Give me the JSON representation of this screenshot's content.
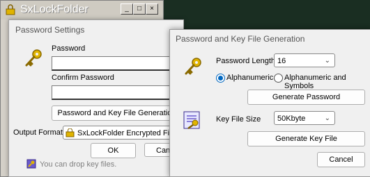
{
  "app": {
    "title": "SxLockFolder"
  },
  "password_settings": {
    "title": "Password Settings",
    "password_label": "Password",
    "password_value": "",
    "confirm_label": "Confirm Password",
    "confirm_value": "",
    "generation_button": "Password and Key File Generation",
    "output_format_label": "Output Format",
    "output_format_value": "SxLockFolder Encrypted File",
    "ok_button": "OK",
    "cancel_button": "Cancel",
    "drop_hint": "You can drop key files."
  },
  "generation_dialog": {
    "title": "Password and Key File Generation",
    "length_label": "Password Length",
    "length_value": "16",
    "radio_alphanumeric": "Alphanumeric",
    "radio_symbols": "Alphanumeric and Symbols",
    "selected_option": "Alphanumeric",
    "generate_password_button": "Generate Password",
    "key_file_size_label": "Key File Size",
    "key_file_size_value": "50Kbyte",
    "generate_key_file_button": "Generate Key File",
    "cancel_button": "Cancel"
  },
  "colors": {
    "accent": "#0067c0",
    "key_icon": "#e0b400",
    "background": "#1a2e22"
  }
}
